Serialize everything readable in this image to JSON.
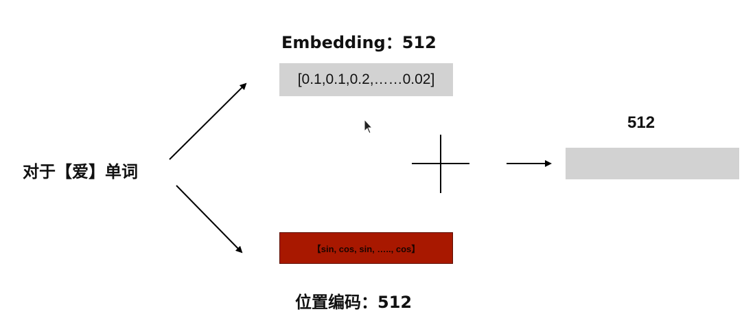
{
  "word_label": "对于【爱】单词",
  "embedding": {
    "title": "Embedding：512",
    "vector": "[0.1,0.1,0.2,……0.02]"
  },
  "positional": {
    "vector": "【sin,  cos,  sin,  …..,  cos】",
    "title": "位置编码：512"
  },
  "result": {
    "title": "512"
  },
  "colors": {
    "embedding_box": "#d2d2d2",
    "positional_box": "#a81800",
    "result_box": "#d2d2d2",
    "arrows": "#000000"
  },
  "icons": {
    "operator": "plus-icon",
    "cursor": "mouse-cursor-icon"
  }
}
